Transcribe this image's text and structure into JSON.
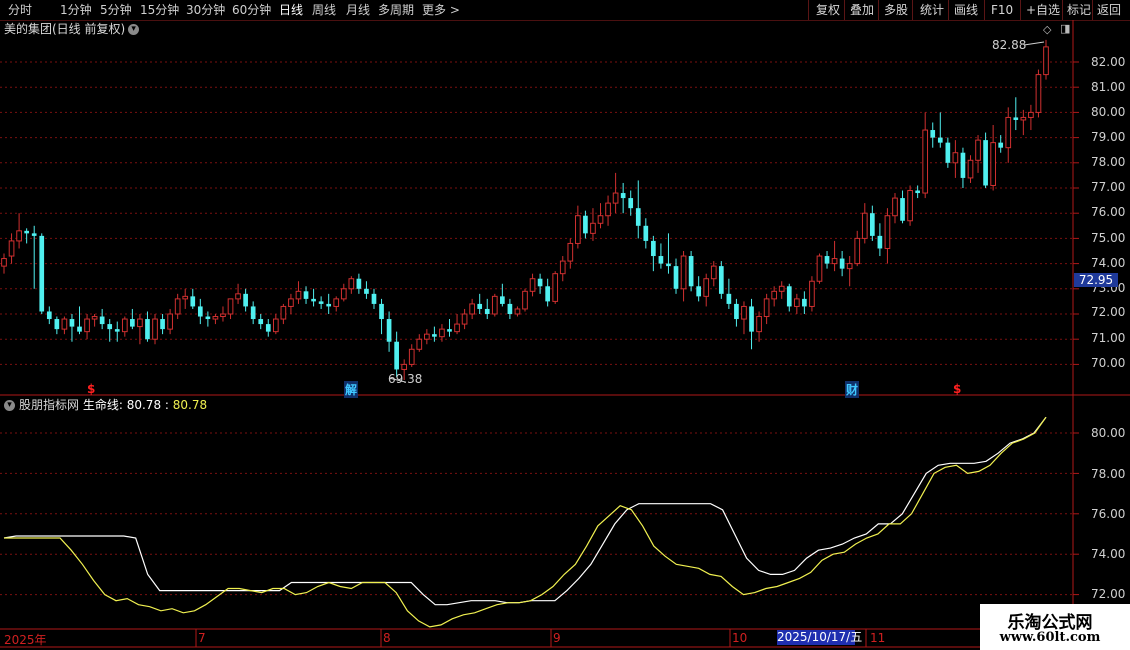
{
  "toolbar": {
    "periods": [
      "分时",
      "1分钟",
      "5分钟",
      "15分钟",
      "30分钟",
      "60分钟",
      "日线",
      "周线",
      "月线",
      "多周期",
      "更多 >"
    ],
    "active_period": "日线",
    "right_buttons": [
      "复权",
      "叠加",
      "多股",
      "统计",
      "画线",
      "F10",
      "+自选",
      "标记",
      "返回"
    ]
  },
  "main_chart": {
    "title": "美的集团(日线 前复权)",
    "high_label": "82.88",
    "low_label": "69.38",
    "current_price": "72.95",
    "y_ticks": [
      "82.00",
      "81.00",
      "80.00",
      "79.00",
      "78.00",
      "77.00",
      "76.00",
      "75.00",
      "74.00",
      "73.00",
      "72.00",
      "71.00",
      "70.00"
    ],
    "events": [
      {
        "label": "$",
        "color": "#ff2020"
      },
      {
        "label": "解",
        "color": "#40c8ff"
      },
      {
        "label": "财",
        "color": "#40c8ff"
      },
      {
        "label": "$",
        "color": "#ff2020"
      }
    ]
  },
  "indicator": {
    "name": "股朋指标网",
    "line_label": "生命线:",
    "value1": "80.78",
    "separator": ":",
    "value2": "80.78",
    "y_ticks": [
      "80.00",
      "78.00",
      "76.00",
      "74.00",
      "72.00"
    ]
  },
  "x_axis": {
    "labels": [
      "2025年",
      "7",
      "8",
      "9",
      "10",
      "11"
    ],
    "highlight": "2025/10/17/五"
  },
  "watermark": {
    "line1": "乐淘公式网",
    "line2": "www.60lt.com"
  },
  "chart_data": {
    "type": "candlestick",
    "up_color": "#d03030",
    "down_color": "#50f0f0",
    "ylim": [
      69.4,
      82.9
    ],
    "candles": [
      [
        73.9,
        74.4,
        73.6,
        74.2
      ],
      [
        74.3,
        75.2,
        74.0,
        74.9
      ],
      [
        74.9,
        76.0,
        74.6,
        75.3
      ],
      [
        75.3,
        75.4,
        74.8,
        75.2
      ],
      [
        75.2,
        75.5,
        73.0,
        75.1
      ],
      [
        75.1,
        75.2,
        72.0,
        72.1
      ],
      [
        72.1,
        72.3,
        71.6,
        71.8
      ],
      [
        71.8,
        71.9,
        71.2,
        71.4
      ],
      [
        71.4,
        71.9,
        71.2,
        71.8
      ],
      [
        71.8,
        72.0,
        70.9,
        71.5
      ],
      [
        71.5,
        72.3,
        71.2,
        71.3
      ],
      [
        71.3,
        72.0,
        71.0,
        71.8
      ],
      [
        71.8,
        72.0,
        71.5,
        71.9
      ],
      [
        71.9,
        72.2,
        71.4,
        71.6
      ],
      [
        71.6,
        71.8,
        70.9,
        71.4
      ],
      [
        71.4,
        71.7,
        70.9,
        71.3
      ],
      [
        71.3,
        71.9,
        71.1,
        71.8
      ],
      [
        71.8,
        72.2,
        71.4,
        71.5
      ],
      [
        71.5,
        72.0,
        70.8,
        71.8
      ],
      [
        71.8,
        72.1,
        70.9,
        71.0
      ],
      [
        71.0,
        72.0,
        70.8,
        71.8
      ],
      [
        71.8,
        72.0,
        71.2,
        71.4
      ],
      [
        71.4,
        72.2,
        71.2,
        72.0
      ],
      [
        72.0,
        72.8,
        71.8,
        72.6
      ],
      [
        72.6,
        73.0,
        72.2,
        72.7
      ],
      [
        72.7,
        73.0,
        72.2,
        72.3
      ],
      [
        72.3,
        72.6,
        71.6,
        71.9
      ],
      [
        71.9,
        72.1,
        71.5,
        71.8
      ],
      [
        71.8,
        72.0,
        71.6,
        71.9
      ],
      [
        71.9,
        72.3,
        71.7,
        72.0
      ],
      [
        72.0,
        72.5,
        71.8,
        72.6
      ],
      [
        72.6,
        73.2,
        72.4,
        72.8
      ],
      [
        72.8,
        73.0,
        72.1,
        72.3
      ],
      [
        72.3,
        72.5,
        71.6,
        71.8
      ],
      [
        71.8,
        72.0,
        71.4,
        71.6
      ],
      [
        71.6,
        71.8,
        71.1,
        71.3
      ],
      [
        71.3,
        72.0,
        71.2,
        71.8
      ],
      [
        71.8,
        72.4,
        71.6,
        72.3
      ],
      [
        72.3,
        72.8,
        72.0,
        72.6
      ],
      [
        72.6,
        73.3,
        72.4,
        72.9
      ],
      [
        72.9,
        73.1,
        72.4,
        72.6
      ],
      [
        72.6,
        73.0,
        72.3,
        72.5
      ],
      [
        72.5,
        72.7,
        72.2,
        72.4
      ],
      [
        72.4,
        72.8,
        72.0,
        72.3
      ],
      [
        72.3,
        72.7,
        72.1,
        72.6
      ],
      [
        72.6,
        73.2,
        72.5,
        73.0
      ],
      [
        73.0,
        73.5,
        72.8,
        73.4
      ],
      [
        73.4,
        73.6,
        72.8,
        73.0
      ],
      [
        73.0,
        73.3,
        72.6,
        72.8
      ],
      [
        72.8,
        73.0,
        72.2,
        72.4
      ],
      [
        72.4,
        72.6,
        71.2,
        71.8
      ],
      [
        71.8,
        72.1,
        70.5,
        70.9
      ],
      [
        70.9,
        71.3,
        69.5,
        69.8
      ],
      [
        69.8,
        70.2,
        69.38,
        70.0
      ],
      [
        70.0,
        70.8,
        69.9,
        70.6
      ],
      [
        70.6,
        71.2,
        70.5,
        71.0
      ],
      [
        71.0,
        71.4,
        70.8,
        71.2
      ],
      [
        71.2,
        71.5,
        70.9,
        71.1
      ],
      [
        71.1,
        71.6,
        70.9,
        71.4
      ],
      [
        71.4,
        71.8,
        71.1,
        71.3
      ],
      [
        71.3,
        72.0,
        71.2,
        71.6
      ],
      [
        71.6,
        72.2,
        71.4,
        72.0
      ],
      [
        72.0,
        72.6,
        71.8,
        72.4
      ],
      [
        72.4,
        72.8,
        72.0,
        72.2
      ],
      [
        72.2,
        72.6,
        71.8,
        72.0
      ],
      [
        72.0,
        72.8,
        71.9,
        72.7
      ],
      [
        72.7,
        73.2,
        72.3,
        72.4
      ],
      [
        72.4,
        72.6,
        71.8,
        72.0
      ],
      [
        72.0,
        72.3,
        71.9,
        72.2
      ],
      [
        72.2,
        73.0,
        72.1,
        72.9
      ],
      [
        72.9,
        73.6,
        72.7,
        73.4
      ],
      [
        73.4,
        73.6,
        72.8,
        73.1
      ],
      [
        73.1,
        73.4,
        72.3,
        72.5
      ],
      [
        72.5,
        73.7,
        72.4,
        73.6
      ],
      [
        73.6,
        74.3,
        73.3,
        74.1
      ],
      [
        74.1,
        75.0,
        73.8,
        74.8
      ],
      [
        74.8,
        76.3,
        74.6,
        75.9
      ],
      [
        75.9,
        76.1,
        75.0,
        75.2
      ],
      [
        75.2,
        76.2,
        74.9,
        75.6
      ],
      [
        75.6,
        76.4,
        75.4,
        75.9
      ],
      [
        75.9,
        76.7,
        75.5,
        76.4
      ],
      [
        76.4,
        77.6,
        76.0,
        76.8
      ],
      [
        76.8,
        77.2,
        76.0,
        76.6
      ],
      [
        76.6,
        76.9,
        75.9,
        76.2
      ],
      [
        76.2,
        77.3,
        75.0,
        75.5
      ],
      [
        75.5,
        75.8,
        74.6,
        74.9
      ],
      [
        74.9,
        75.1,
        73.7,
        74.3
      ],
      [
        74.3,
        74.8,
        73.8,
        74.0
      ],
      [
        74.0,
        75.2,
        73.6,
        73.9
      ],
      [
        73.9,
        74.2,
        72.8,
        73.0
      ],
      [
        73.0,
        74.5,
        72.5,
        74.3
      ],
      [
        74.3,
        74.5,
        72.9,
        73.1
      ],
      [
        73.1,
        73.5,
        72.5,
        72.7
      ],
      [
        72.7,
        73.6,
        72.3,
        73.4
      ],
      [
        73.4,
        74.1,
        73.1,
        73.9
      ],
      [
        73.9,
        74.1,
        72.6,
        72.8
      ],
      [
        72.8,
        73.4,
        72.2,
        72.4
      ],
      [
        72.4,
        72.6,
        71.5,
        71.8
      ],
      [
        71.8,
        72.5,
        71.2,
        72.3
      ],
      [
        72.3,
        72.6,
        70.6,
        71.3
      ],
      [
        71.3,
        72.1,
        70.9,
        71.9
      ],
      [
        71.9,
        72.8,
        71.6,
        72.6
      ],
      [
        72.6,
        73.1,
        72.3,
        72.9
      ],
      [
        72.9,
        73.3,
        72.6,
        73.1
      ],
      [
        73.1,
        73.2,
        72.1,
        72.3
      ],
      [
        72.3,
        72.8,
        72.0,
        72.6
      ],
      [
        72.6,
        72.9,
        72.0,
        72.3
      ],
      [
        72.3,
        73.5,
        72.1,
        73.3
      ],
      [
        73.3,
        74.4,
        73.2,
        74.3
      ],
      [
        74.3,
        74.5,
        73.8,
        74.0
      ],
      [
        74.0,
        74.9,
        73.7,
        74.2
      ],
      [
        74.2,
        74.5,
        73.5,
        73.8
      ],
      [
        73.8,
        74.3,
        73.1,
        74.0
      ],
      [
        74.0,
        75.3,
        73.9,
        75.0
      ],
      [
        75.0,
        76.4,
        74.8,
        76.0
      ],
      [
        76.0,
        76.3,
        74.9,
        75.1
      ],
      [
        75.1,
        75.6,
        74.3,
        74.6
      ],
      [
        74.6,
        76.2,
        74.0,
        75.9
      ],
      [
        75.9,
        76.8,
        75.6,
        76.6
      ],
      [
        76.6,
        76.9,
        75.6,
        75.7
      ],
      [
        75.7,
        77.1,
        75.5,
        76.9
      ],
      [
        76.9,
        77.1,
        76.6,
        76.8
      ],
      [
        76.8,
        80.0,
        76.6,
        79.3
      ],
      [
        79.3,
        79.6,
        78.6,
        79.0
      ],
      [
        79.0,
        80.0,
        78.6,
        78.8
      ],
      [
        78.8,
        79.0,
        77.8,
        78.0
      ],
      [
        78.0,
        78.9,
        77.4,
        78.4
      ],
      [
        78.4,
        78.6,
        77.0,
        77.4
      ],
      [
        77.4,
        78.3,
        77.2,
        78.1
      ],
      [
        78.1,
        79.1,
        77.6,
        78.9
      ],
      [
        78.9,
        79.2,
        77.0,
        77.1
      ],
      [
        77.1,
        79.5,
        76.9,
        78.8
      ],
      [
        78.8,
        79.1,
        78.4,
        78.6
      ],
      [
        78.6,
        80.2,
        78.0,
        79.8
      ],
      [
        79.8,
        80.6,
        79.3,
        79.7
      ],
      [
        79.7,
        80.1,
        79.1,
        79.8
      ],
      [
        79.8,
        80.3,
        79.3,
        80.0
      ],
      [
        80.0,
        81.7,
        79.8,
        81.5
      ],
      [
        81.5,
        82.88,
        81.3,
        82.6
      ]
    ],
    "indicator_lines": [
      {
        "name": "生命线",
        "color": "#f0f050",
        "values": [
          74.8,
          74.8,
          74.8,
          74.8,
          74.8,
          74.8,
          74.2,
          73.5,
          72.7,
          72.0,
          71.7,
          71.8,
          71.5,
          71.4,
          71.2,
          71.3,
          71.1,
          71.2,
          71.5,
          71.9,
          72.3,
          72.3,
          72.2,
          72.1,
          72.3,
          72.3,
          72.0,
          72.1,
          72.4,
          72.6,
          72.4,
          72.3,
          72.6,
          72.6,
          72.6,
          72.1,
          71.2,
          70.7,
          70.4,
          70.5,
          70.8,
          71.0,
          71.1,
          71.3,
          71.5,
          71.6,
          71.6,
          71.7,
          72.0,
          72.4,
          73.0,
          73.5,
          74.4,
          75.4,
          75.9,
          76.4,
          76.2,
          75.4,
          74.4,
          73.9,
          73.5,
          73.4,
          73.3,
          73.0,
          72.9,
          72.4,
          72.0,
          72.1,
          72.3,
          72.4,
          72.6,
          72.8,
          73.1,
          73.7,
          74.0,
          74.1,
          74.5,
          74.8,
          75.0,
          75.5,
          75.5,
          76.0,
          77.0,
          78.0,
          78.3,
          78.4,
          78.0,
          78.1,
          78.4,
          79.0,
          79.5,
          79.7,
          80.0,
          80.78
        ]
      },
      {
        "name": "",
        "color": "#ffffff",
        "values": [
          74.8,
          74.9,
          74.9,
          74.9,
          74.9,
          74.9,
          74.9,
          74.9,
          74.9,
          74.9,
          74.9,
          74.8,
          73.0,
          72.2,
          72.2,
          72.2,
          72.2,
          72.2,
          72.2,
          72.2,
          72.2,
          72.2,
          72.2,
          72.2,
          72.6,
          72.6,
          72.6,
          72.6,
          72.6,
          72.6,
          72.6,
          72.6,
          72.6,
          72.6,
          72.6,
          72.0,
          71.5,
          71.5,
          71.6,
          71.7,
          71.7,
          71.7,
          71.6,
          71.6,
          71.7,
          71.7,
          71.7,
          72.2,
          72.8,
          73.5,
          74.5,
          75.5,
          76.2,
          76.5,
          76.5,
          76.5,
          76.5,
          76.5,
          76.5,
          76.5,
          76.2,
          75.0,
          73.8,
          73.2,
          73.0,
          73.0,
          73.2,
          73.8,
          74.2,
          74.3,
          74.5,
          74.8,
          75.0,
          75.5,
          75.5,
          76.0,
          77.0,
          78.0,
          78.4,
          78.5,
          78.5,
          78.5,
          78.6,
          79.0,
          79.5,
          79.7,
          80.0,
          80.78
        ]
      }
    ],
    "indicator_ylim": [
      71.7,
      81.0
    ]
  }
}
